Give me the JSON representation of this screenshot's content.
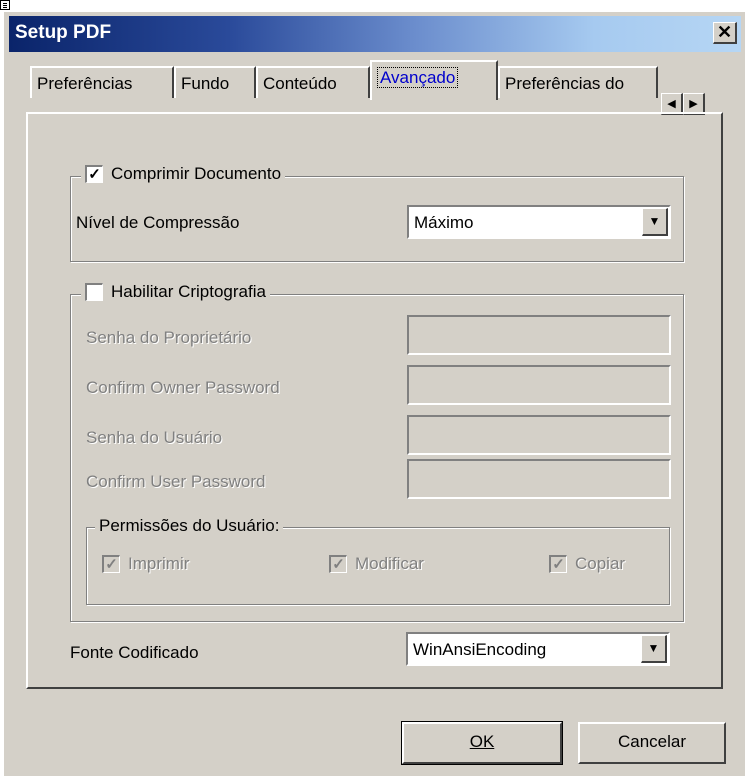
{
  "window": {
    "title": "Setup PDF",
    "close_glyph": "✕"
  },
  "tabs": [
    {
      "label": "Preferências"
    },
    {
      "label": "Fundo"
    },
    {
      "label": "Conteúdo"
    },
    {
      "label": "Avançado"
    },
    {
      "label": "Preferências do"
    }
  ],
  "active_tab": "Avançado",
  "tab_scroll": {
    "left_icon": "arrow-left-icon",
    "right_icon": "arrow-right-icon"
  },
  "compression": {
    "checkbox_label": "Comprimir Documento",
    "checked": true,
    "level_label": "Nível de Compressão",
    "level_value": "Máximo"
  },
  "encryption": {
    "checkbox_label": "Habilitar Criptografia",
    "checked": false,
    "fields": [
      {
        "label": "Senha do Proprietário",
        "value": ""
      },
      {
        "label": "Confirm Owner Password",
        "value": ""
      },
      {
        "label": "Senha do Usuário",
        "value": ""
      },
      {
        "label": "Confirm User Password",
        "value": ""
      }
    ],
    "permissions": {
      "title": "Permissões do Usuário:",
      "items": [
        {
          "label": "Imprimir",
          "checked": true
        },
        {
          "label": "Modificar",
          "checked": true
        },
        {
          "label": "Copiar",
          "checked": true
        }
      ]
    }
  },
  "font_encoding": {
    "label": "Fonte Codificado",
    "value": "WinAnsiEncoding"
  },
  "buttons": {
    "ok_label": "OK",
    "cancel_label": "Cancelar"
  },
  "colors": {
    "face": "#d4d0c8",
    "title_start": "#0a246a",
    "title_end": "#a6caf0",
    "active_tab_text": "#0000cc",
    "disabled_text": "#808080"
  }
}
